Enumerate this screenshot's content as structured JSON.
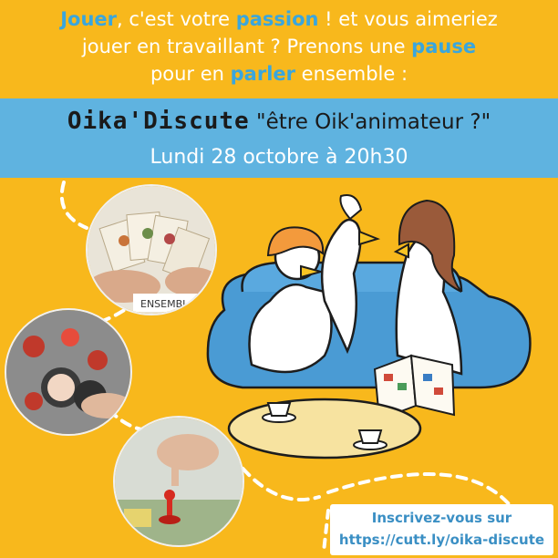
{
  "intro": {
    "l1_a": "Jouer",
    "l1_b": ", c'est votre ",
    "l1_c": "passion",
    "l1_d": " ! et vous aimeriez",
    "l2_a": "jouer en travaillant ? Prenons une ",
    "l2_b": "pause",
    "l3_a": "pour en ",
    "l3_b": "parler",
    "l3_c": " ensemble :"
  },
  "band": {
    "brand": "Oika'Discute",
    "subject": " \"être Oik'animateur ?\"",
    "date": "Lundi 28 octobre à 20h30"
  },
  "photos": {
    "card_text": "ENSEMBL"
  },
  "cta": {
    "line1": "Inscrivez-vous sur",
    "line2": "https://cutt.ly/oika-discute"
  },
  "colors": {
    "background": "#f8b81c",
    "band": "#5fb3e0",
    "highlight": "#3aa6dd",
    "link": "#3a8fc4"
  }
}
